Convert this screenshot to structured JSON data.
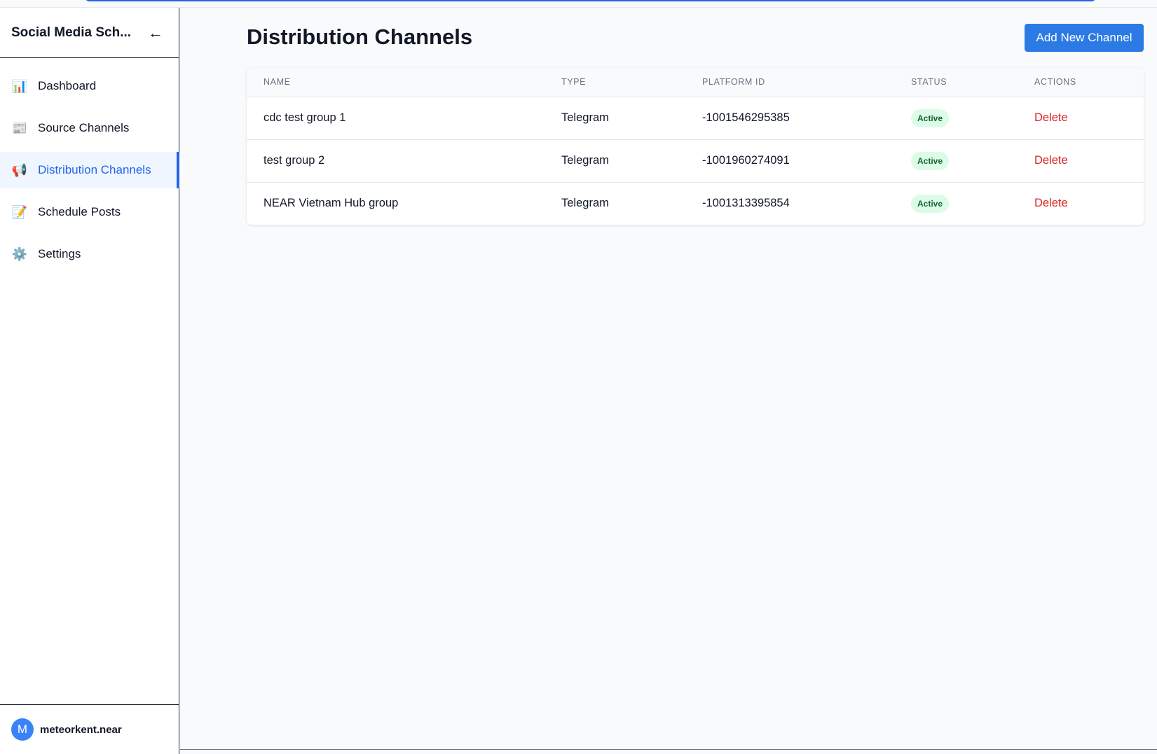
{
  "app": {
    "title": "Social Media Sch...",
    "back_icon": "arrow-left-icon"
  },
  "sidebar": {
    "items": [
      {
        "label": "Dashboard",
        "icon": "📊",
        "icon_name": "bar-chart-icon",
        "active": false
      },
      {
        "label": "Source Channels",
        "icon": "📰",
        "icon_name": "newspaper-icon",
        "active": false
      },
      {
        "label": "Distribution Channels",
        "icon": "📢",
        "icon_name": "megaphone-icon",
        "active": true
      },
      {
        "label": "Schedule Posts",
        "icon": "📝",
        "icon_name": "memo-icon",
        "active": false
      },
      {
        "label": "Settings",
        "icon": "⚙️",
        "icon_name": "gear-icon",
        "active": false
      }
    ],
    "user": {
      "initial": "M",
      "name": "meteorkent.near"
    }
  },
  "main": {
    "title": "Distribution Channels",
    "add_button_label": "Add New Channel",
    "table": {
      "columns": [
        "NAME",
        "TYPE",
        "PLATFORM ID",
        "STATUS",
        "ACTIONS"
      ],
      "rows": [
        {
          "name": "cdc test group 1",
          "type": "Telegram",
          "platform_id": "-1001546295385",
          "status": "Active",
          "action": "Delete"
        },
        {
          "name": "test group 2",
          "type": "Telegram",
          "platform_id": "-1001960274091",
          "status": "Active",
          "action": "Delete"
        },
        {
          "name": "NEAR Vietnam Hub group",
          "type": "Telegram",
          "platform_id": "-1001313395854",
          "status": "Active",
          "action": "Delete"
        }
      ]
    }
  },
  "colors": {
    "accent": "#2563eb",
    "button": "#2c7be5",
    "status_bg": "#dcfce7",
    "status_text": "#166534",
    "danger": "#dc2626"
  }
}
